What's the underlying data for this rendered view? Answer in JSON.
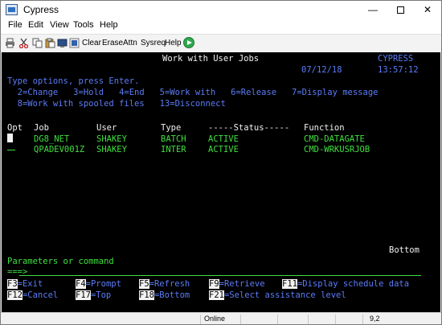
{
  "window": {
    "title": "Cypress",
    "minimize": "—",
    "close": "✕"
  },
  "menu": [
    "File",
    "Edit",
    "View",
    "Tools",
    "Help"
  ],
  "toolbar": {
    "clear": "Clear",
    "erase": "Erase",
    "attn": "Attn",
    "sysreq": "Sysreq",
    "help": "Help"
  },
  "screen": {
    "title": "Work with User Jobs",
    "system": "CYPRESS",
    "date": "07/12/18",
    "time": "13:57:12",
    "instructions": "Type options, press Enter.",
    "options_line1": "  2=Change   3=Hold   4=End   5=Work with   6=Release   7=Display message",
    "options_line2": "  8=Work with spooled files   13=Disconnect",
    "headers": {
      "opt": "Opt",
      "job": "Job",
      "user": "User",
      "type": "Type",
      "status": "-----Status-----",
      "function": "Function"
    },
    "rows": [
      {
        "job": "DG8_NET",
        "user": "SHAKEY",
        "type": "BATCH",
        "status": "ACTIVE",
        "function": "CMD-DATAGATE"
      },
      {
        "job": "QPADEV001Z",
        "user": "SHAKEY",
        "type": "INTER",
        "status": "ACTIVE",
        "function": "CMD-WRKUSRJOB"
      }
    ],
    "bottom": "Bottom",
    "params_label": "Parameters or command",
    "prompt": "===>",
    "fkeys_row1": [
      {
        "key": "F3",
        "label": "=Exit"
      },
      {
        "key": "F4",
        "label": "=Prompt"
      },
      {
        "key": "F5",
        "label": "=Refresh"
      },
      {
        "key": "F9",
        "label": "=Retrieve"
      },
      {
        "key": "F11",
        "label": "=Display schedule data"
      }
    ],
    "fkeys_row2": [
      {
        "key": "F12",
        "label": "=Cancel"
      },
      {
        "key": "F17",
        "label": "=Top"
      },
      {
        "key": "F18",
        "label": "=Bottom"
      },
      {
        "key": "F21",
        "label": "=Select assistance level"
      }
    ]
  },
  "status": {
    "state": "Online",
    "position": "9,2"
  },
  "colors": {
    "screen_bg": "#000000",
    "field_green": "#3fe03f",
    "text_blue": "#5c7cf7",
    "highlight_white": "#f2f2f2"
  }
}
